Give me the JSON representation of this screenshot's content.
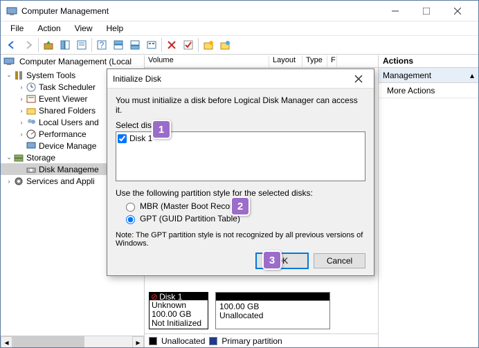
{
  "window": {
    "title": "Computer Management",
    "min": "Minimize",
    "max": "Maximize",
    "close": "Close"
  },
  "menu": {
    "file": "File",
    "action": "Action",
    "view": "View",
    "help": "Help"
  },
  "tree": {
    "root": "Computer Management (Local",
    "systools": "System Tools",
    "task": "Task Scheduler",
    "event": "Event Viewer",
    "shared": "Shared Folders",
    "users": "Local Users and",
    "perf": "Performance",
    "device": "Device Manage",
    "storage": "Storage",
    "diskmgmt": "Disk Manageme",
    "services": "Services and Appli"
  },
  "cols": {
    "volume": "Volume",
    "layout": "Layout",
    "type": "Type",
    "fs": "F"
  },
  "disk": {
    "name": "Disk 1",
    "status1": "Unknown",
    "size": "100.00 GB",
    "status2": "Not Initialized"
  },
  "vol": {
    "size": "100.00 GB",
    "status": "Unallocated"
  },
  "legend": {
    "unalloc": "Unallocated",
    "primary": "Primary partition"
  },
  "actions": {
    "header": "Actions",
    "section": "Management",
    "more": "More Actions"
  },
  "dialog": {
    "title": "Initialize Disk",
    "msg": "You must initialize a disk before Logical Disk Manager can access it.",
    "selectdisks": "Select disks:",
    "disk1": "Disk 1",
    "disk1_checked": true,
    "partstyle": "Use the following partition style for the selected disks:",
    "mbr": "MBR (Master Boot Record)",
    "gpt": "GPT (GUID Partition Table)",
    "selected_style": "gpt",
    "note": "Note: The GPT partition style is not recognized by all previous versions of Windows.",
    "ok": "OK",
    "cancel": "Cancel"
  },
  "callouts": {
    "c1": "1",
    "c2": "2",
    "c3": "3"
  }
}
